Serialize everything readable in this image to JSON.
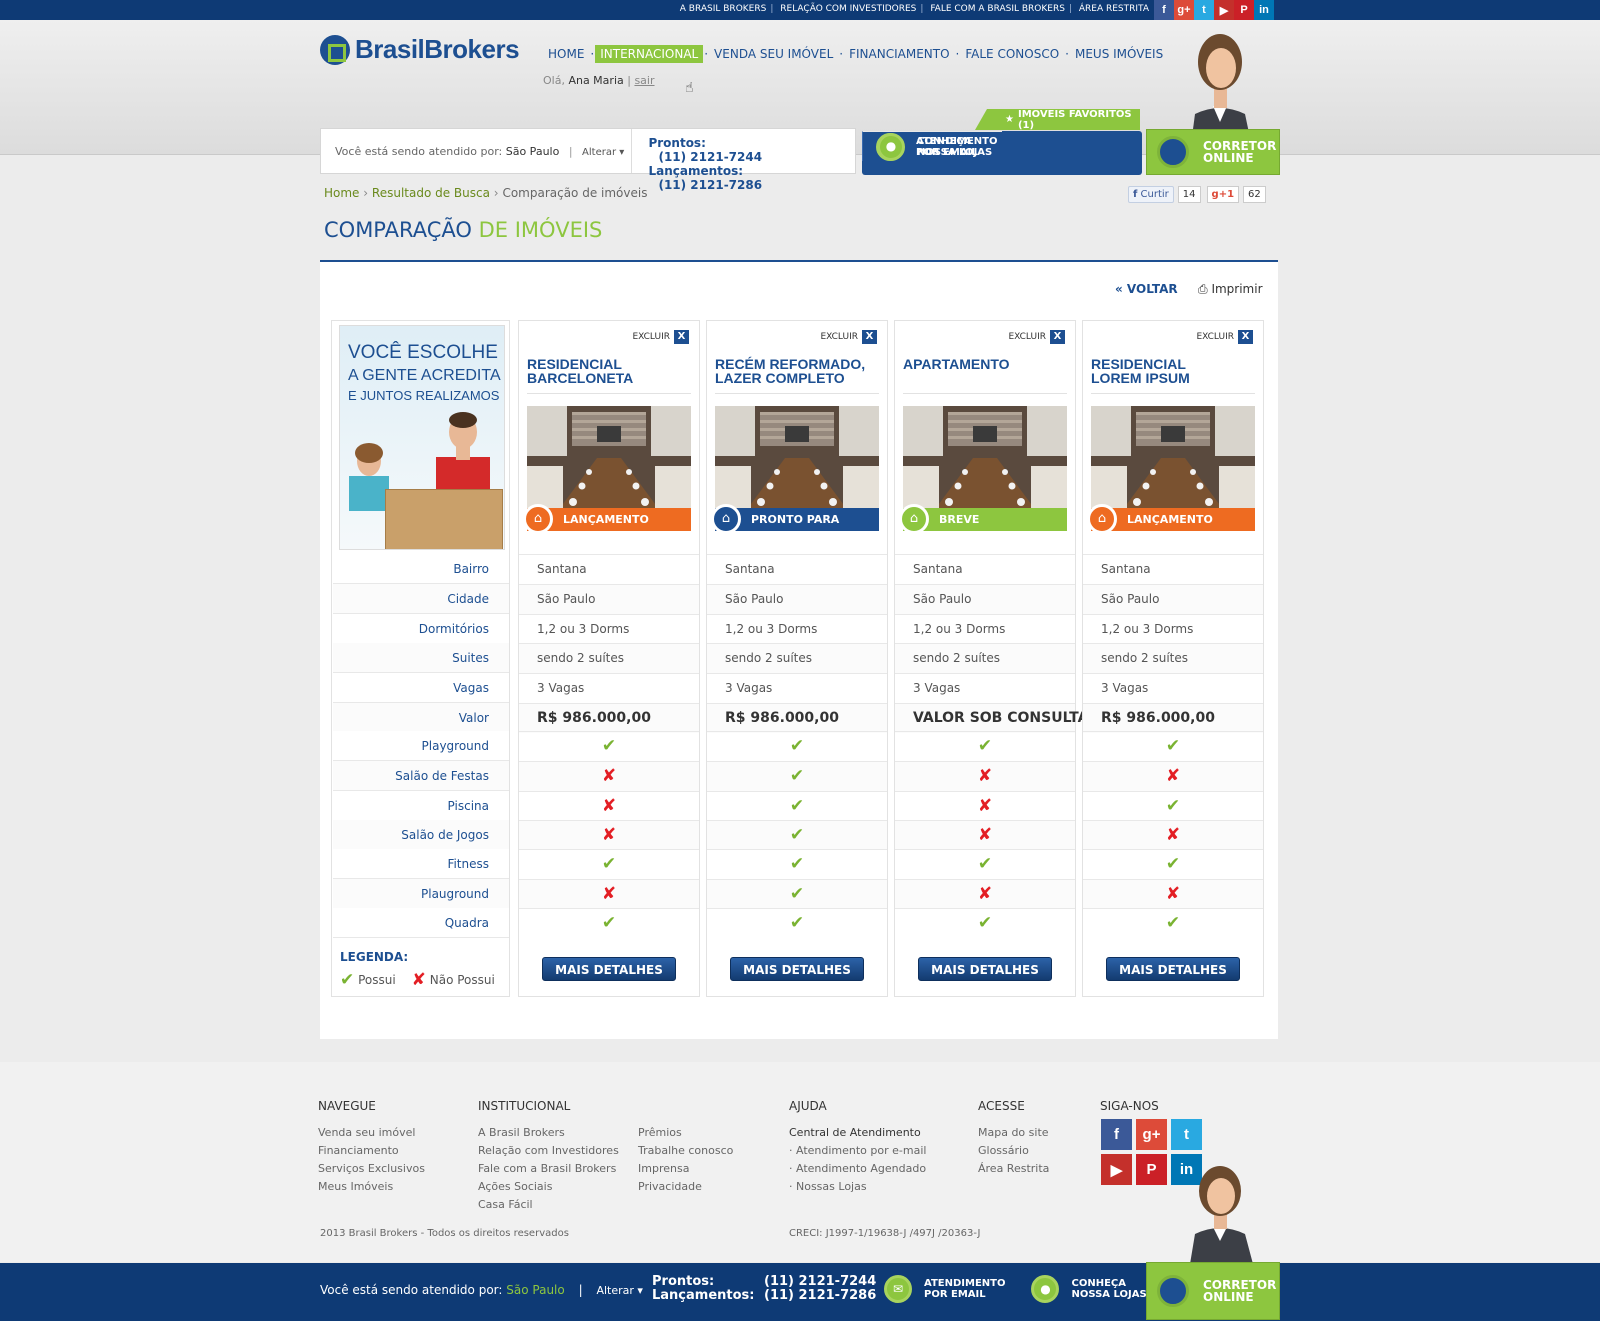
{
  "topbar": {
    "links": [
      "A BRASIL BROKERS",
      "RELAÇÃO COM INVESTIDORES",
      "FALE COM A BRASIL BROKERS",
      "ÁREA RESTRITA"
    ],
    "social": [
      {
        "icon": "facebook-icon",
        "glyph": "f",
        "color": "#3b5998"
      },
      {
        "icon": "google-plus-icon",
        "glyph": "g+",
        "color": "#dd4b39"
      },
      {
        "icon": "twitter-icon",
        "glyph": "t",
        "color": "#29a9e1"
      },
      {
        "icon": "youtube-icon",
        "glyph": "▶",
        "color": "#c4302b"
      },
      {
        "icon": "pinterest-icon",
        "glyph": "P",
        "color": "#cb2027"
      },
      {
        "icon": "linkedin-icon",
        "glyph": "in",
        "color": "#0077b5"
      }
    ]
  },
  "logo": {
    "brand1": "Brasil",
    "brand2": "Brokers"
  },
  "nav": {
    "items": [
      "HOME",
      "INTERNACIONAL",
      "VENDA SEU IMÓVEL",
      "FINANCIAMENTO",
      "FALE CONOSCO",
      "MEUS IMÓVEIS"
    ],
    "active_index": 1
  },
  "greeting": {
    "prefix": "Olá,",
    "name": "Ana Maria",
    "logout": "sair"
  },
  "favorites": {
    "label": "IMÓVEIS FAVORITOS (1)"
  },
  "service": {
    "label": "Você está sendo atendido por:",
    "city": "São Paulo",
    "change": "Alterar",
    "prontos_label": "Prontos:",
    "prontos_phone": "(11) 2121-7244",
    "lanc_label": "Lançamentos:",
    "lanc_phone": "(11) 2121-7286"
  },
  "contact": {
    "email_l1": "ATENDIMENTO",
    "email_l2": "POR EMAIL",
    "stores_l1": "CONHEÇA",
    "stores_l2": "NOSSA LOJAS",
    "online_l1": "CORRETOR",
    "online_l2": "ONLINE"
  },
  "breadcrumb": {
    "home": "Home",
    "search": "Resultado de Busca",
    "current": "Comparação de imóveis"
  },
  "social_counts": {
    "like": "Curtir",
    "like_count": "14",
    "plus": "+1",
    "plus_count": "62"
  },
  "title": {
    "part1": "COMPARAÇÃO",
    "part2": "DE IMÓVEIS"
  },
  "actions": {
    "back": "« VOLTAR",
    "print": "Imprimir"
  },
  "promo": {
    "line1": "VOCÊ ESCOLHE",
    "line2": "A GENTE ACREDITA",
    "line3": "E JUNTOS REALIZAMOS"
  },
  "row_labels": [
    "Bairro",
    "Cidade",
    "Dormitórios",
    "Suites",
    "Vagas",
    "Valor",
    "Playground",
    "Salão de Festas",
    "Piscina",
    "Salão de Jogos",
    "Fitness",
    "Plauground",
    "Quadra"
  ],
  "legend": {
    "title": "LEGENDA:",
    "yes": "Possui",
    "no": "Não Possui"
  },
  "exclude_label": "EXCLUIR",
  "details_label": "MAIS DETALHES",
  "properties": [
    {
      "title_l1": "RESIDENCIAL",
      "title_l2": "BARCELONETA",
      "status": "LANÇAMENTO",
      "status_color": "#ee6b21",
      "bairro": "Santana",
      "cidade": "São Paulo",
      "dorms": "1,2 ou 3 Dorms",
      "suites": "sendo 2 suítes",
      "vagas": "3 Vagas",
      "valor": "R$ 986.000,00",
      "features": [
        true,
        false,
        false,
        false,
        true,
        false,
        true
      ]
    },
    {
      "title_l1": "RECÉM REFORMADO,",
      "title_l2": "LAZER COMPLETO",
      "status": "PRONTO PARA MORAR",
      "status_color": "#1d4f91",
      "bairro": "Santana",
      "cidade": "São Paulo",
      "dorms": "1,2 ou 3 Dorms",
      "suites": "sendo 2 suítes",
      "vagas": "3 Vagas",
      "valor": "R$ 986.000,00",
      "features": [
        true,
        true,
        true,
        true,
        true,
        true,
        true
      ]
    },
    {
      "title_l1": "APARTAMENTO",
      "title_l2": "",
      "status": "BREVE LANÇAMENTO",
      "status_color": "#8dc63f",
      "bairro": "Santana",
      "cidade": "São Paulo",
      "dorms": "1,2 ou 3 Dorms",
      "suites": "sendo 2 suítes",
      "vagas": "3 Vagas",
      "valor": "VALOR SOB CONSULTA",
      "features": [
        true,
        false,
        false,
        false,
        true,
        false,
        true
      ]
    },
    {
      "title_l1": "RESIDENCIAL",
      "title_l2": "LOREM IPSUM",
      "status": "LANÇAMENTO",
      "status_color": "#ee6b21",
      "bairro": "Santana",
      "cidade": "São Paulo",
      "dorms": "1,2 ou 3 Dorms",
      "suites": "sendo 2 suítes",
      "vagas": "3 Vagas",
      "valor": "R$ 986.000,00",
      "features": [
        true,
        false,
        true,
        false,
        true,
        false,
        true
      ]
    }
  ],
  "footer": {
    "navegue": {
      "title": "NAVEGUE",
      "items": [
        "Venda seu imóvel",
        "Financiamento",
        "Serviços Exclusivos",
        "Meus Imóveis"
      ]
    },
    "institucional": {
      "title": "INSTITUCIONAL",
      "items": [
        "A Brasil Brokers",
        "Relação com Investidores",
        "Fale com a Brasil Brokers",
        "Ações Sociais",
        "Casa Fácil"
      ],
      "items2": [
        "Prêmios",
        "Trabalhe conosco",
        "Imprensa",
        "Privacidade"
      ]
    },
    "ajuda": {
      "title": "AJUDA",
      "head": "Central de Atendimento",
      "items": [
        "· Atendimento por e-mail",
        "· Atendimento Agendado",
        "· Nossas Lojas"
      ]
    },
    "acesse": {
      "title": "ACESSE",
      "items": [
        "Mapa do site",
        "Glossário",
        "Área Restrita"
      ]
    },
    "siga": {
      "title": "SIGA-NOS"
    },
    "copyright": "2013 Brasil Brokers - Todos os direitos reservados",
    "creci": "CRECI: J1997-1/19638-J /497J /20363-J"
  }
}
